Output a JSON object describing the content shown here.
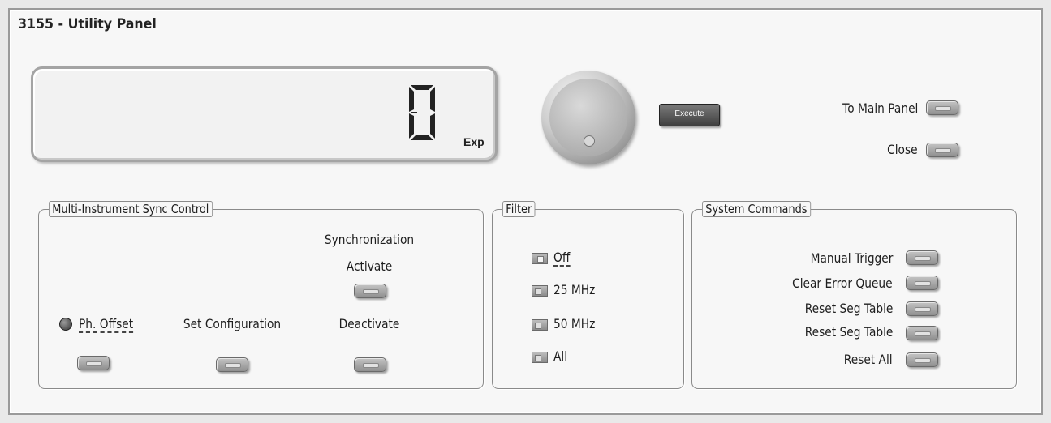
{
  "window": {
    "title": "3155 - Utility Panel"
  },
  "display": {
    "digit": "0",
    "exp_label": "Exp"
  },
  "knob": {
    "execute_label": "Execute"
  },
  "nav": {
    "main_panel_label": "To Main Panel",
    "close_label": "Close"
  },
  "sync": {
    "group_title": "Multi-Instrument Sync Control",
    "synchronization_label": "Synchronization",
    "activate_label": "Activate",
    "deactivate_label": "Deactivate",
    "ph_offset_label": "Ph. Offset",
    "set_configuration_label": "Set Configuration"
  },
  "filter": {
    "group_title": "Filter",
    "options": [
      "Off",
      "25 MHz",
      "50 MHz",
      "All"
    ],
    "selected": "Off"
  },
  "system": {
    "group_title": "System Commands",
    "commands": [
      "Manual Trigger",
      "Clear Error Queue",
      "Reset Seg Table",
      "Reset Seg Table",
      "Reset All"
    ]
  },
  "colors": {
    "panel": "#f7f7f7",
    "button": "#a8a8a8",
    "execute": "#4a4a4a"
  }
}
